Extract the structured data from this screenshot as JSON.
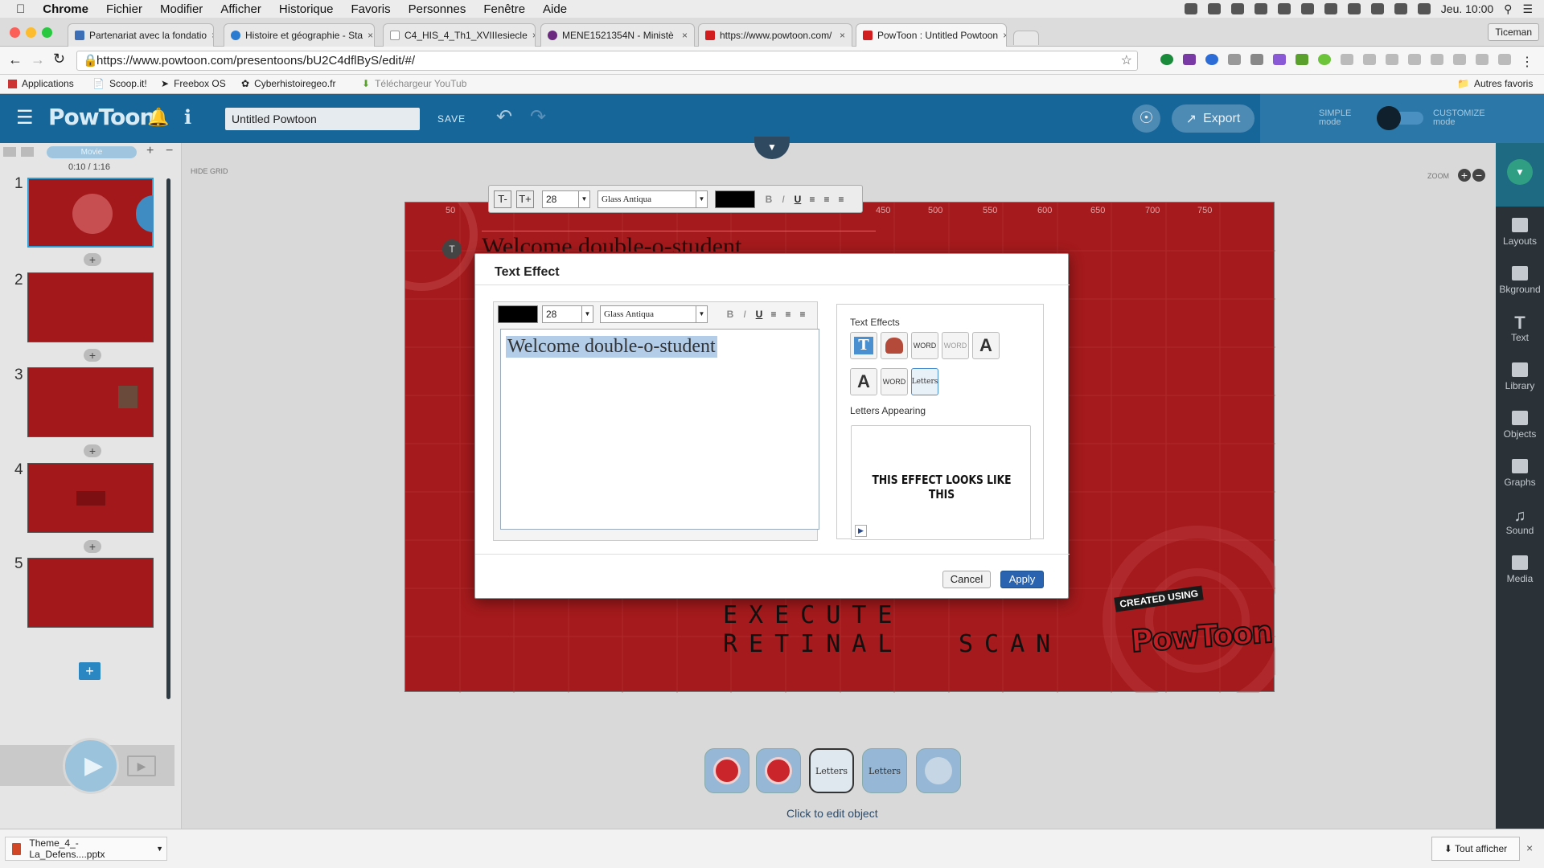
{
  "menubar": {
    "app": "Chrome",
    "items": [
      "Fichier",
      "Modifier",
      "Afficher",
      "Historique",
      "Favoris",
      "Personnes",
      "Fenêtre",
      "Aide"
    ],
    "clock": "Jeu. 10:00"
  },
  "tabs": [
    {
      "title": "Partenariat avec la fondatio",
      "color": "#3d6fb6"
    },
    {
      "title": "Histoire et géographie - Sta",
      "color": "#2b7bd1"
    },
    {
      "title": "C4_HIS_4_Th1_XVIIIesiecle",
      "color": "#ffffff"
    },
    {
      "title": "MENE1521354N - Ministè",
      "color": "#6b2a7f"
    },
    {
      "title": "https://www.powtoon.com/",
      "color": "#d11d1d"
    },
    {
      "title": "PowToon : Untitled Powtoon",
      "color": "#d11d1d"
    }
  ],
  "profile": "Ticeman",
  "address": {
    "url": "https://www.powtoon.com/presentoons/bU2C4dflByS/edit/#/"
  },
  "bookmarks": [
    "Applications",
    "Scoop.it!",
    "Freebox OS",
    "Cyberhistoiregeo.fr",
    "Téléchargeur YouTub",
    "Autres favoris"
  ],
  "powtoon": {
    "title": "Untitled Powtoon",
    "save": "SAVE",
    "export": "Export",
    "simple": "SIMPLE",
    "simple_mode": "mode",
    "customize": "CUSTOMIZE",
    "customize_mode": "mode",
    "timecode": "0:10 / 1:16",
    "mode_label": "Movie",
    "hide_grid": "HIDE GRID",
    "zoom": "ZOOM",
    "slides": [
      "1",
      "2",
      "3",
      "4",
      "5"
    ]
  },
  "textbar": {
    "size": "28",
    "font": "Glass Antiqua"
  },
  "rightbar": [
    "Layouts",
    "Bkground",
    "Text",
    "Library",
    "Objects",
    "Graphs",
    "Sound",
    "Media"
  ],
  "canvas": {
    "heading": "Welcome double-o-student",
    "line1": "EXECUTE",
    "line2a": "RETINAL",
    "line2b": "SCAN",
    "badge": "CREATED USING",
    "logo": "PowToon",
    "ruler": [
      "50",
      "450",
      "500",
      "550",
      "600",
      "650",
      "700",
      "750"
    ]
  },
  "dialog": {
    "title": "Text Effect",
    "size": "28",
    "font": "Glass Antiqua",
    "text": "Welcome double-o-student",
    "effects_label": "Text Effects",
    "effect_word": "WORD",
    "effect_letters": "Letters",
    "effect_a": "A",
    "effect_t": "T",
    "appearing_label": "Letters Appearing",
    "preview": "THIS EFFECT LOOKS LIKE THIS",
    "cancel": "Cancel",
    "apply": "Apply"
  },
  "bottom": {
    "letters": "Letters",
    "hint": "Click to edit object"
  },
  "download": {
    "file": "Theme_4_-La_Defens....pptx",
    "show_all": "Tout afficher"
  }
}
